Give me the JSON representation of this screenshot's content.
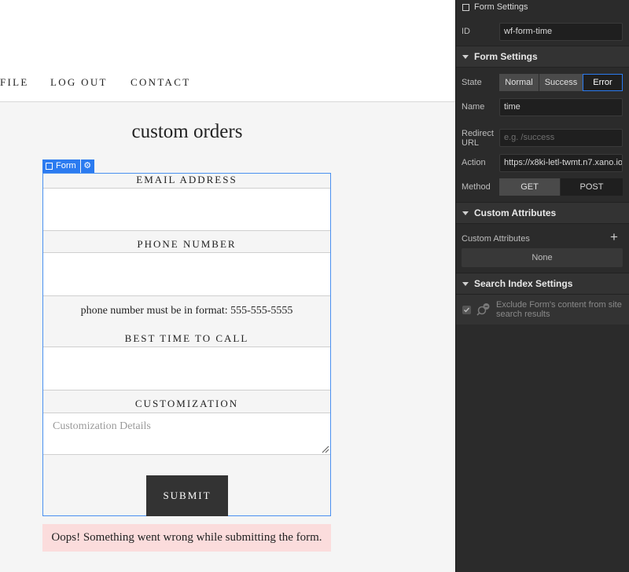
{
  "nav": {
    "profile": "FILE",
    "logout": "LOG OUT",
    "contact": "CONTACT"
  },
  "page": {
    "heading": "custom orders"
  },
  "form_tag": {
    "label": "Form",
    "gear_icon": "gear-icon"
  },
  "form": {
    "email_label": "EMAIL ADDRESS",
    "phone_label": "PHONE NUMBER",
    "phone_helper": "phone number must be in format: 555-555-5555",
    "time_label": "BEST TIME TO CALL",
    "custom_label": "CUSTOMIZATION",
    "custom_placeholder": "Customization Details",
    "submit_label": "SUBMIT",
    "error_message": "Oops! Something went wrong while submitting the form."
  },
  "panel": {
    "title": "Form Settings",
    "id_label": "ID",
    "id_value": "wf-form-time",
    "form_settings_header": "Form Settings",
    "state_label": "State",
    "states": [
      "Normal",
      "Success",
      "Error"
    ],
    "state_selected": "Error",
    "name_label": "Name",
    "name_value": "time",
    "redirect_label_1": "Redirect",
    "redirect_label_2": "URL",
    "redirect_placeholder": "e.g. /success",
    "action_label": "Action",
    "action_value": "https://x8ki-letl-twmt.n7.xano.io",
    "method_label": "Method",
    "methods": [
      "GET",
      "POST"
    ],
    "method_selected": "GET",
    "custom_attrs_header": "Custom Attributes",
    "custom_attrs_label": "Custom Attributes",
    "custom_attrs_none": "None",
    "search_header": "Search Index Settings",
    "exclude_text": "Exclude Form's content from site search results"
  },
  "colors": {
    "accent": "#2b7bf0",
    "panel_bg": "#2b2b2b",
    "error_bg": "#fbdcdc",
    "submit_bg": "#333333"
  }
}
